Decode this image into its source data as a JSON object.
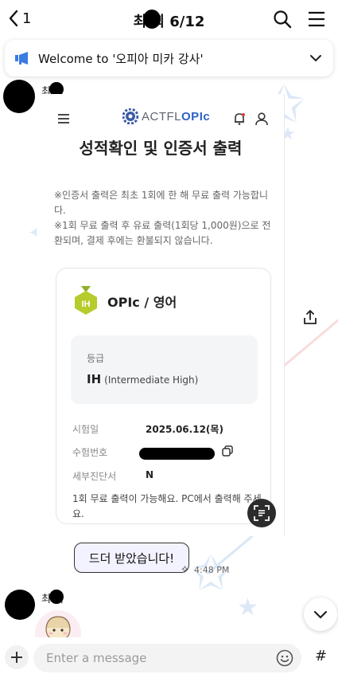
{
  "header": {
    "back_count": "1",
    "title": "최 희 6/12",
    "icons": [
      "back-chevron-icon",
      "search-icon",
      "menu-icon"
    ]
  },
  "notice": {
    "text": "Welcome to '오피아 미카 강사'",
    "icons": [
      "megaphone-icon",
      "chevron-down-icon"
    ]
  },
  "messages": [
    {
      "sender": "최 희",
      "type": "image",
      "image": {
        "heading": "성적확인 및 인증서 출력",
        "notes": [
          "※인증서 출력은 최초 1회에 한 해 무료 출력 가능합니다.",
          "※1회 무료 출력 후 유료 출력(1회당 1,000원)으로 전환되며, 결제 후에는 환불되지 않습니다."
        ],
        "logo": {
          "prefix": "ACTFL",
          "brand": "OPIc"
        },
        "card": {
          "badge": "IH",
          "title": "OPIc / 영어",
          "grade_label": "등급",
          "grade_code": "IH",
          "grade_desc": "(Intermediate High)",
          "rows": [
            {
              "label": "시험일",
              "value": "2025.06.12(목)"
            },
            {
              "label": "수험번호",
              "value": ""
            },
            {
              "label": "세부진단서",
              "value": "N"
            }
          ],
          "footer": "1회 무료 출력이 가능해요. PC에서 출력해 주세요."
        }
      }
    },
    {
      "type": "text",
      "text": "드더 받았습니다!",
      "time": "4:48 PM"
    },
    {
      "sender": "최 희",
      "type": "sticker"
    }
  ],
  "input": {
    "placeholder": "Enter a message",
    "hash_label": "#"
  },
  "colors": {
    "accent": "#2f63c4",
    "bubble_bg": "#f3f2ff",
    "badge_green": "#b5cc2c",
    "notice_icon": "#3a7be0"
  }
}
